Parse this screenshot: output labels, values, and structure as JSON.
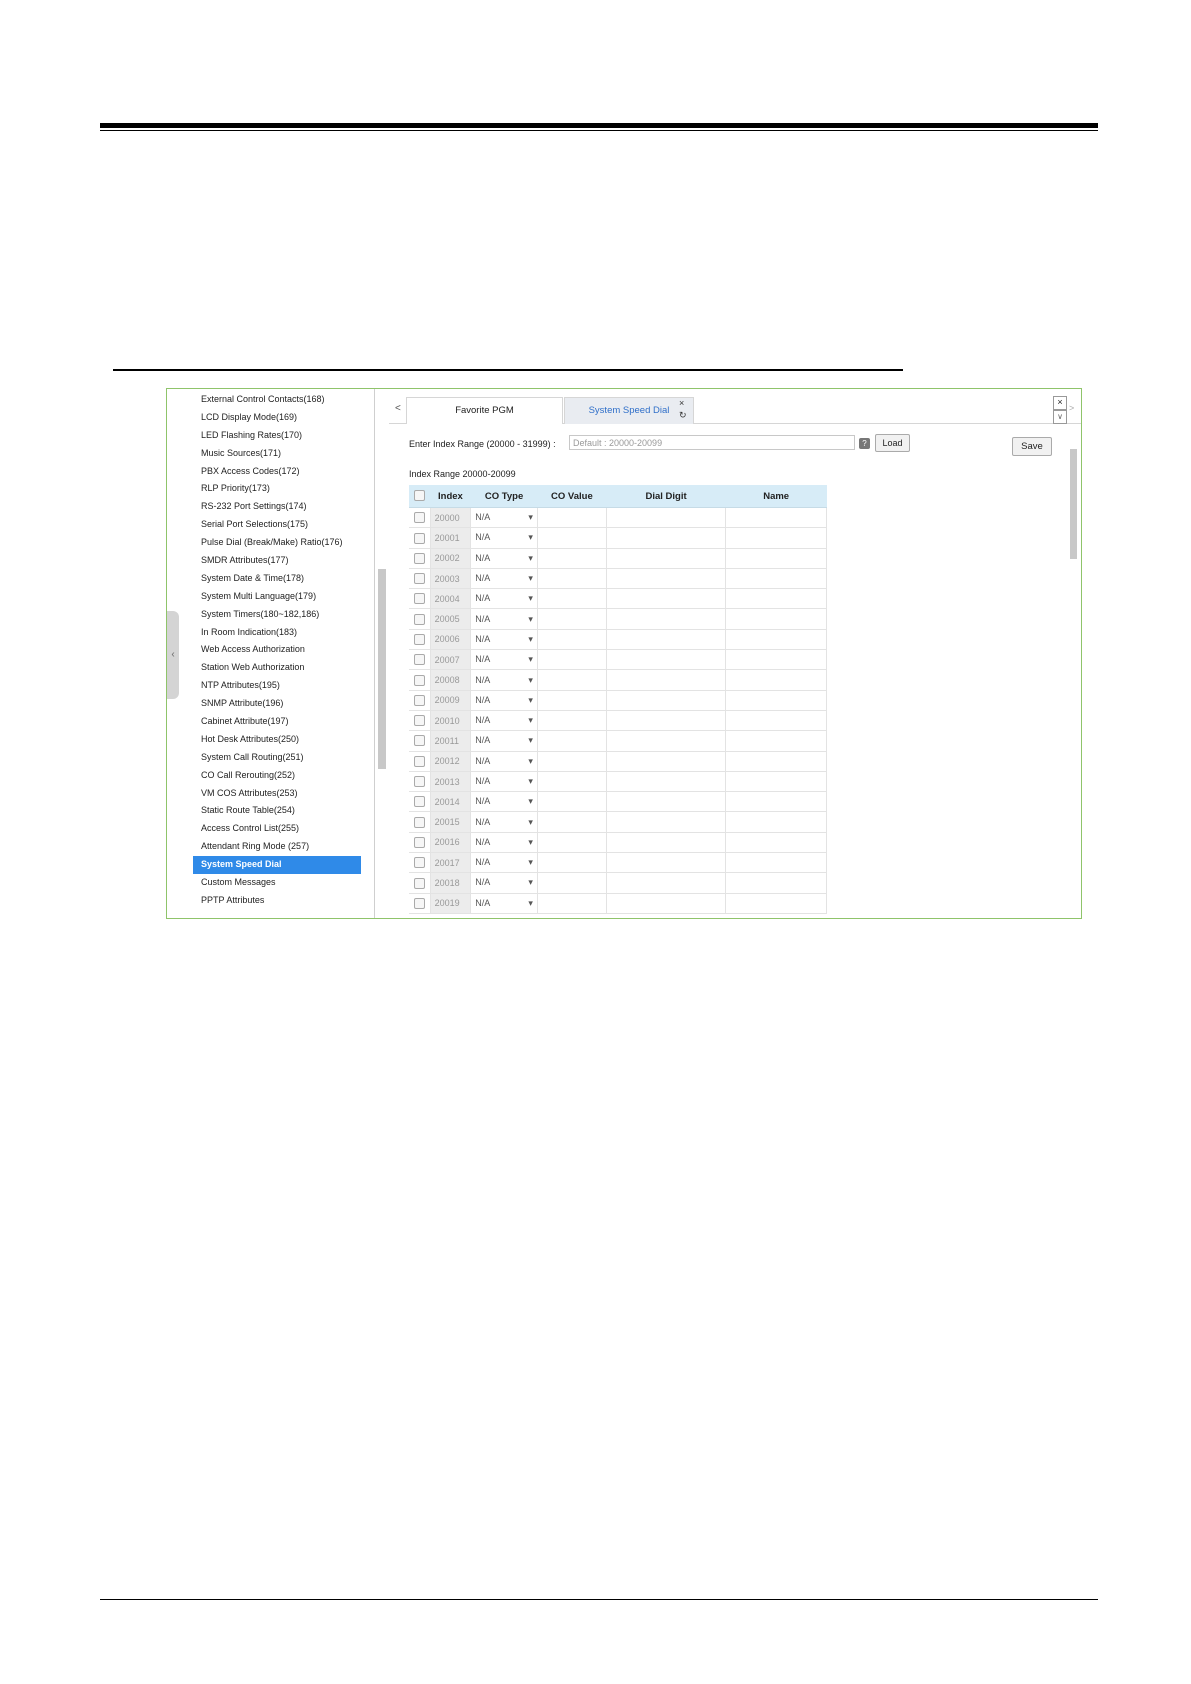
{
  "sidebar": {
    "collapse_glyph": "‹",
    "items": [
      "External Control Contacts(168)",
      "LCD Display Mode(169)",
      "LED Flashing Rates(170)",
      "Music Sources(171)",
      "PBX Access Codes(172)",
      "RLP Priority(173)",
      "RS-232 Port Settings(174)",
      "Serial Port Selections(175)",
      "Pulse Dial (Break/Make) Ratio(176)",
      "SMDR Attributes(177)",
      "System Date & Time(178)",
      "System Multi Language(179)",
      "System Timers(180~182,186)",
      "In Room Indication(183)",
      "Web Access Authorization",
      "Station Web Authorization",
      "NTP Attributes(195)",
      "SNMP Attribute(196)",
      "Cabinet Attribute(197)",
      "Hot Desk Attributes(250)",
      "System Call Routing(251)",
      "CO Call Rerouting(252)",
      "VM COS Attributes(253)",
      "Static Route Table(254)",
      "Access Control List(255)",
      "Attendant Ring Mode (257)",
      "System Speed Dial",
      "Custom Messages",
      "PPTP Attributes"
    ],
    "active_item": "System Speed Dial"
  },
  "tabs": {
    "prev_glyph": "<",
    "favorite": "Favorite PGM",
    "current": "System Speed Dial",
    "close_glyph": "×",
    "refresh_glyph": "↻",
    "window_close_glyph": "×",
    "window_down_glyph": "∨",
    "next_glyph": ">"
  },
  "toolbar": {
    "range_label": "Enter Index Range (20000 - 31999) :",
    "range_placeholder": "Default : 20000-20099",
    "help_glyph": "?",
    "load_label": "Load",
    "save_label": "Save"
  },
  "table": {
    "range_title": "Index Range 20000-20099",
    "headers": [
      "Index",
      "CO Type",
      "CO Value",
      "Dial Digit",
      "Name"
    ],
    "dropdown_glyph": "▾",
    "rows": [
      {
        "index": "20000",
        "co_type": "N/A"
      },
      {
        "index": "20001",
        "co_type": "N/A"
      },
      {
        "index": "20002",
        "co_type": "N/A"
      },
      {
        "index": "20003",
        "co_type": "N/A"
      },
      {
        "index": "20004",
        "co_type": "N/A"
      },
      {
        "index": "20005",
        "co_type": "N/A"
      },
      {
        "index": "20006",
        "co_type": "N/A"
      },
      {
        "index": "20007",
        "co_type": "N/A"
      },
      {
        "index": "20008",
        "co_type": "N/A"
      },
      {
        "index": "20009",
        "co_type": "N/A"
      },
      {
        "index": "20010",
        "co_type": "N/A"
      },
      {
        "index": "20011",
        "co_type": "N/A"
      },
      {
        "index": "20012",
        "co_type": "N/A"
      },
      {
        "index": "20013",
        "co_type": "N/A"
      },
      {
        "index": "20014",
        "co_type": "N/A"
      },
      {
        "index": "20015",
        "co_type": "N/A"
      },
      {
        "index": "20016",
        "co_type": "N/A"
      },
      {
        "index": "20017",
        "co_type": "N/A"
      },
      {
        "index": "20018",
        "co_type": "N/A"
      },
      {
        "index": "20019",
        "co_type": "N/A"
      }
    ]
  }
}
